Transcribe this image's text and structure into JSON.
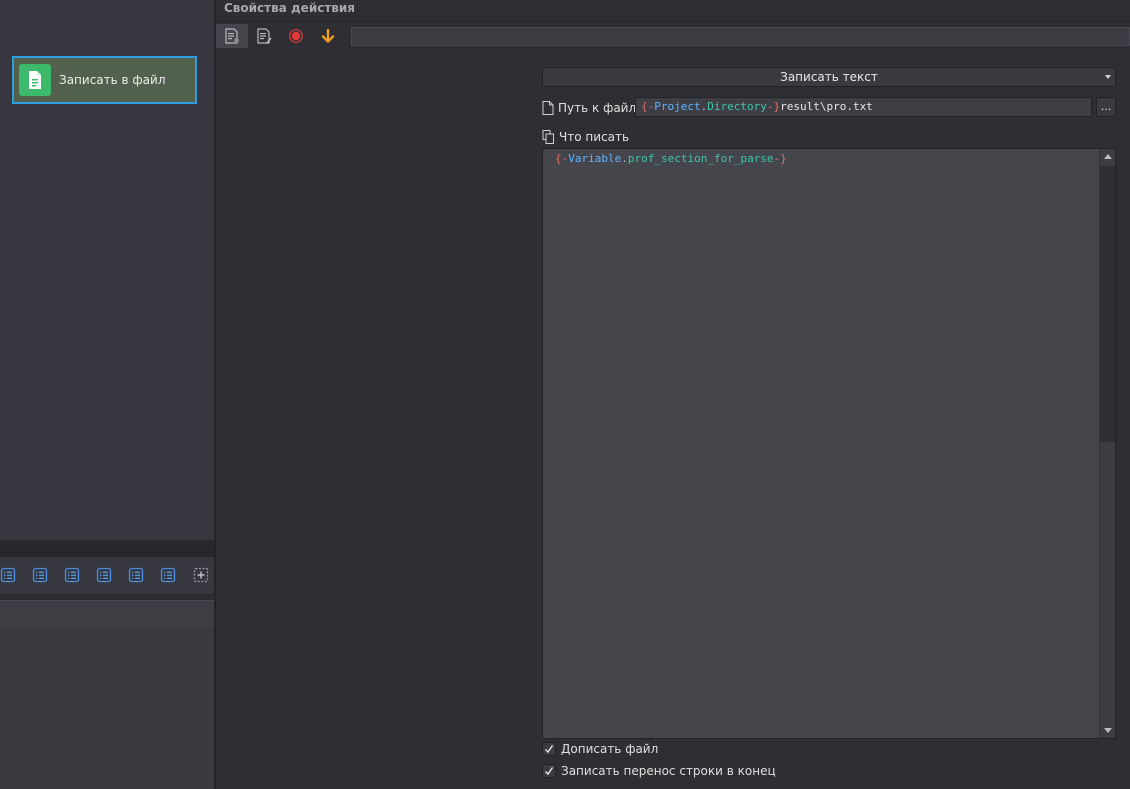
{
  "left_panel": {
    "node": {
      "label": "Записать в файл",
      "icon": "document-icon",
      "accent": "#3cb96b"
    },
    "toolbar_icons": [
      "list-icon",
      "list-icon",
      "list-icon",
      "list-icon",
      "list-icon",
      "list-icon",
      "add-box-icon"
    ]
  },
  "props": {
    "title": "Свойства действия",
    "toolbar": {
      "buttons": [
        "properties-icon",
        "edit-icon",
        "record-icon",
        "arrow-down-icon"
      ],
      "name_value": ""
    },
    "action_select": {
      "value": "Записать текст"
    },
    "path": {
      "label": "Путь к файлу",
      "value": "{-Project.Directory-}result\\pro.txt",
      "tokens": {
        "open": "{-",
        "scope": "Project",
        "dot": ".",
        "name": "Directory",
        "close": "-}",
        "rest": "result\\pro.txt"
      },
      "browse_label": "..."
    },
    "write": {
      "label": "Что писать",
      "value": "{-Variable.prof_section_for_parse-}",
      "tokens": {
        "open": "{-",
        "scope": "Variable",
        "dot": ".",
        "name": "prof_section_for_parse",
        "close": "-}"
      }
    },
    "checkboxes": [
      {
        "label": "Дописать файл",
        "checked": true
      },
      {
        "label": "Записать перенос строки в конец",
        "checked": true
      }
    ]
  },
  "colors": {
    "accent_border": "#2f9fdf",
    "record_red": "#e23b3b",
    "arrow_orange": "#f0a020",
    "token_brace": "#e06c6c",
    "token_scope": "#5fb3ff",
    "token_name": "#3ec7a0"
  }
}
